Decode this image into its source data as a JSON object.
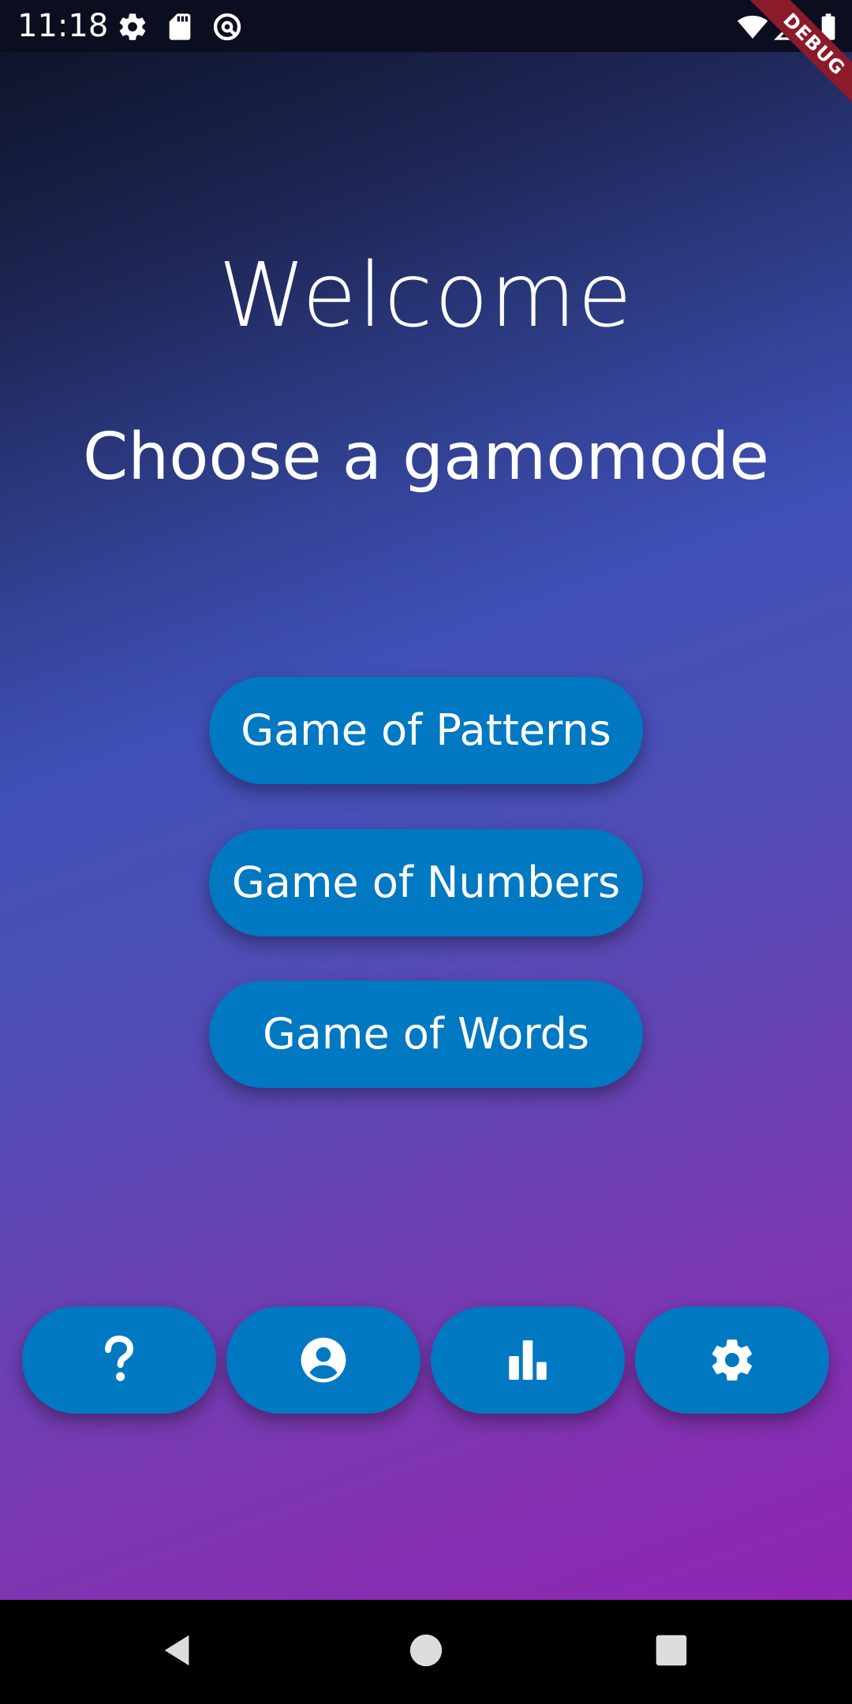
{
  "status_bar": {
    "time": "11:18",
    "icons": [
      "gear-icon",
      "sd-card-icon",
      "location-access-icon",
      "wifi-icon",
      "signal-icon",
      "battery-icon"
    ]
  },
  "debug_banner": {
    "label": "DEBUG"
  },
  "main": {
    "title": "Welcome",
    "subtitle": "Choose a gamomode",
    "modes": [
      {
        "label": "Game of Patterns"
      },
      {
        "label": "Game of Numbers"
      },
      {
        "label": "Game of Words"
      }
    ]
  },
  "bottom_actions": [
    {
      "icon": "help-icon"
    },
    {
      "icon": "account-icon"
    },
    {
      "icon": "stats-icon"
    },
    {
      "icon": "settings-icon"
    }
  ],
  "nav_bar": {
    "buttons": [
      "back-icon",
      "home-icon",
      "recents-icon"
    ]
  },
  "colors": {
    "button": "#0078c2",
    "gradient_top": "#0c1022",
    "gradient_mid": "#4150b8",
    "gradient_bottom": "#9025b2",
    "debug_banner": "#8b1a2a"
  }
}
